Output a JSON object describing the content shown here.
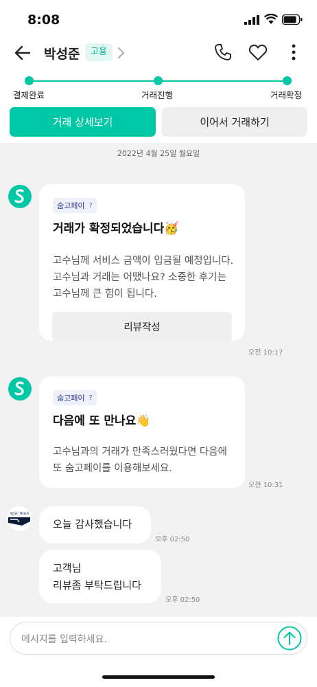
{
  "status_bar": {
    "time": "8:08"
  },
  "header": {
    "name": "박성준",
    "tag": "고용"
  },
  "progress": {
    "steps": [
      {
        "label": "결제완료"
      },
      {
        "label": "거래진행"
      },
      {
        "label": "거래확정"
      }
    ]
  },
  "actions": {
    "primary": "거래 상세보기",
    "secondary": "이어서 거래하기"
  },
  "chat": {
    "date": "2022년 4월 25일 월요일",
    "cards": [
      {
        "badge": "숨고페이",
        "badge_help": "?",
        "title": "거래가 확정되었습니다🥳",
        "body": "고수님께 서비스 금액이 입금될 예정입니다.고수님과 거래는 어땠나요? 소중한 후기는 고수님께 큰 힘이 됩니다.",
        "button": "리뷰작성",
        "time": "오전 10:17"
      },
      {
        "badge": "숨고페이",
        "badge_help": "?",
        "title": "다음에 또 만나요👋",
        "body": "고수님과의 거래가 만족스러웠다면 다음에 또 숨고페이를 이용해보세요.",
        "time": "오전 10:31"
      }
    ],
    "user_avatar_text": "Style Wash",
    "messages": [
      {
        "lines": [
          "오늘 감사했습니다"
        ],
        "time": "오후 02:50"
      },
      {
        "lines": [
          "고객님",
          "리뷰좀 부탁드립니다"
        ],
        "time": "오후 02:50"
      }
    ]
  },
  "input": {
    "placeholder": "메시지를 입력하세요."
  },
  "colors": {
    "accent": "#00c7a5",
    "chat_bg": "#f2f2f2"
  }
}
